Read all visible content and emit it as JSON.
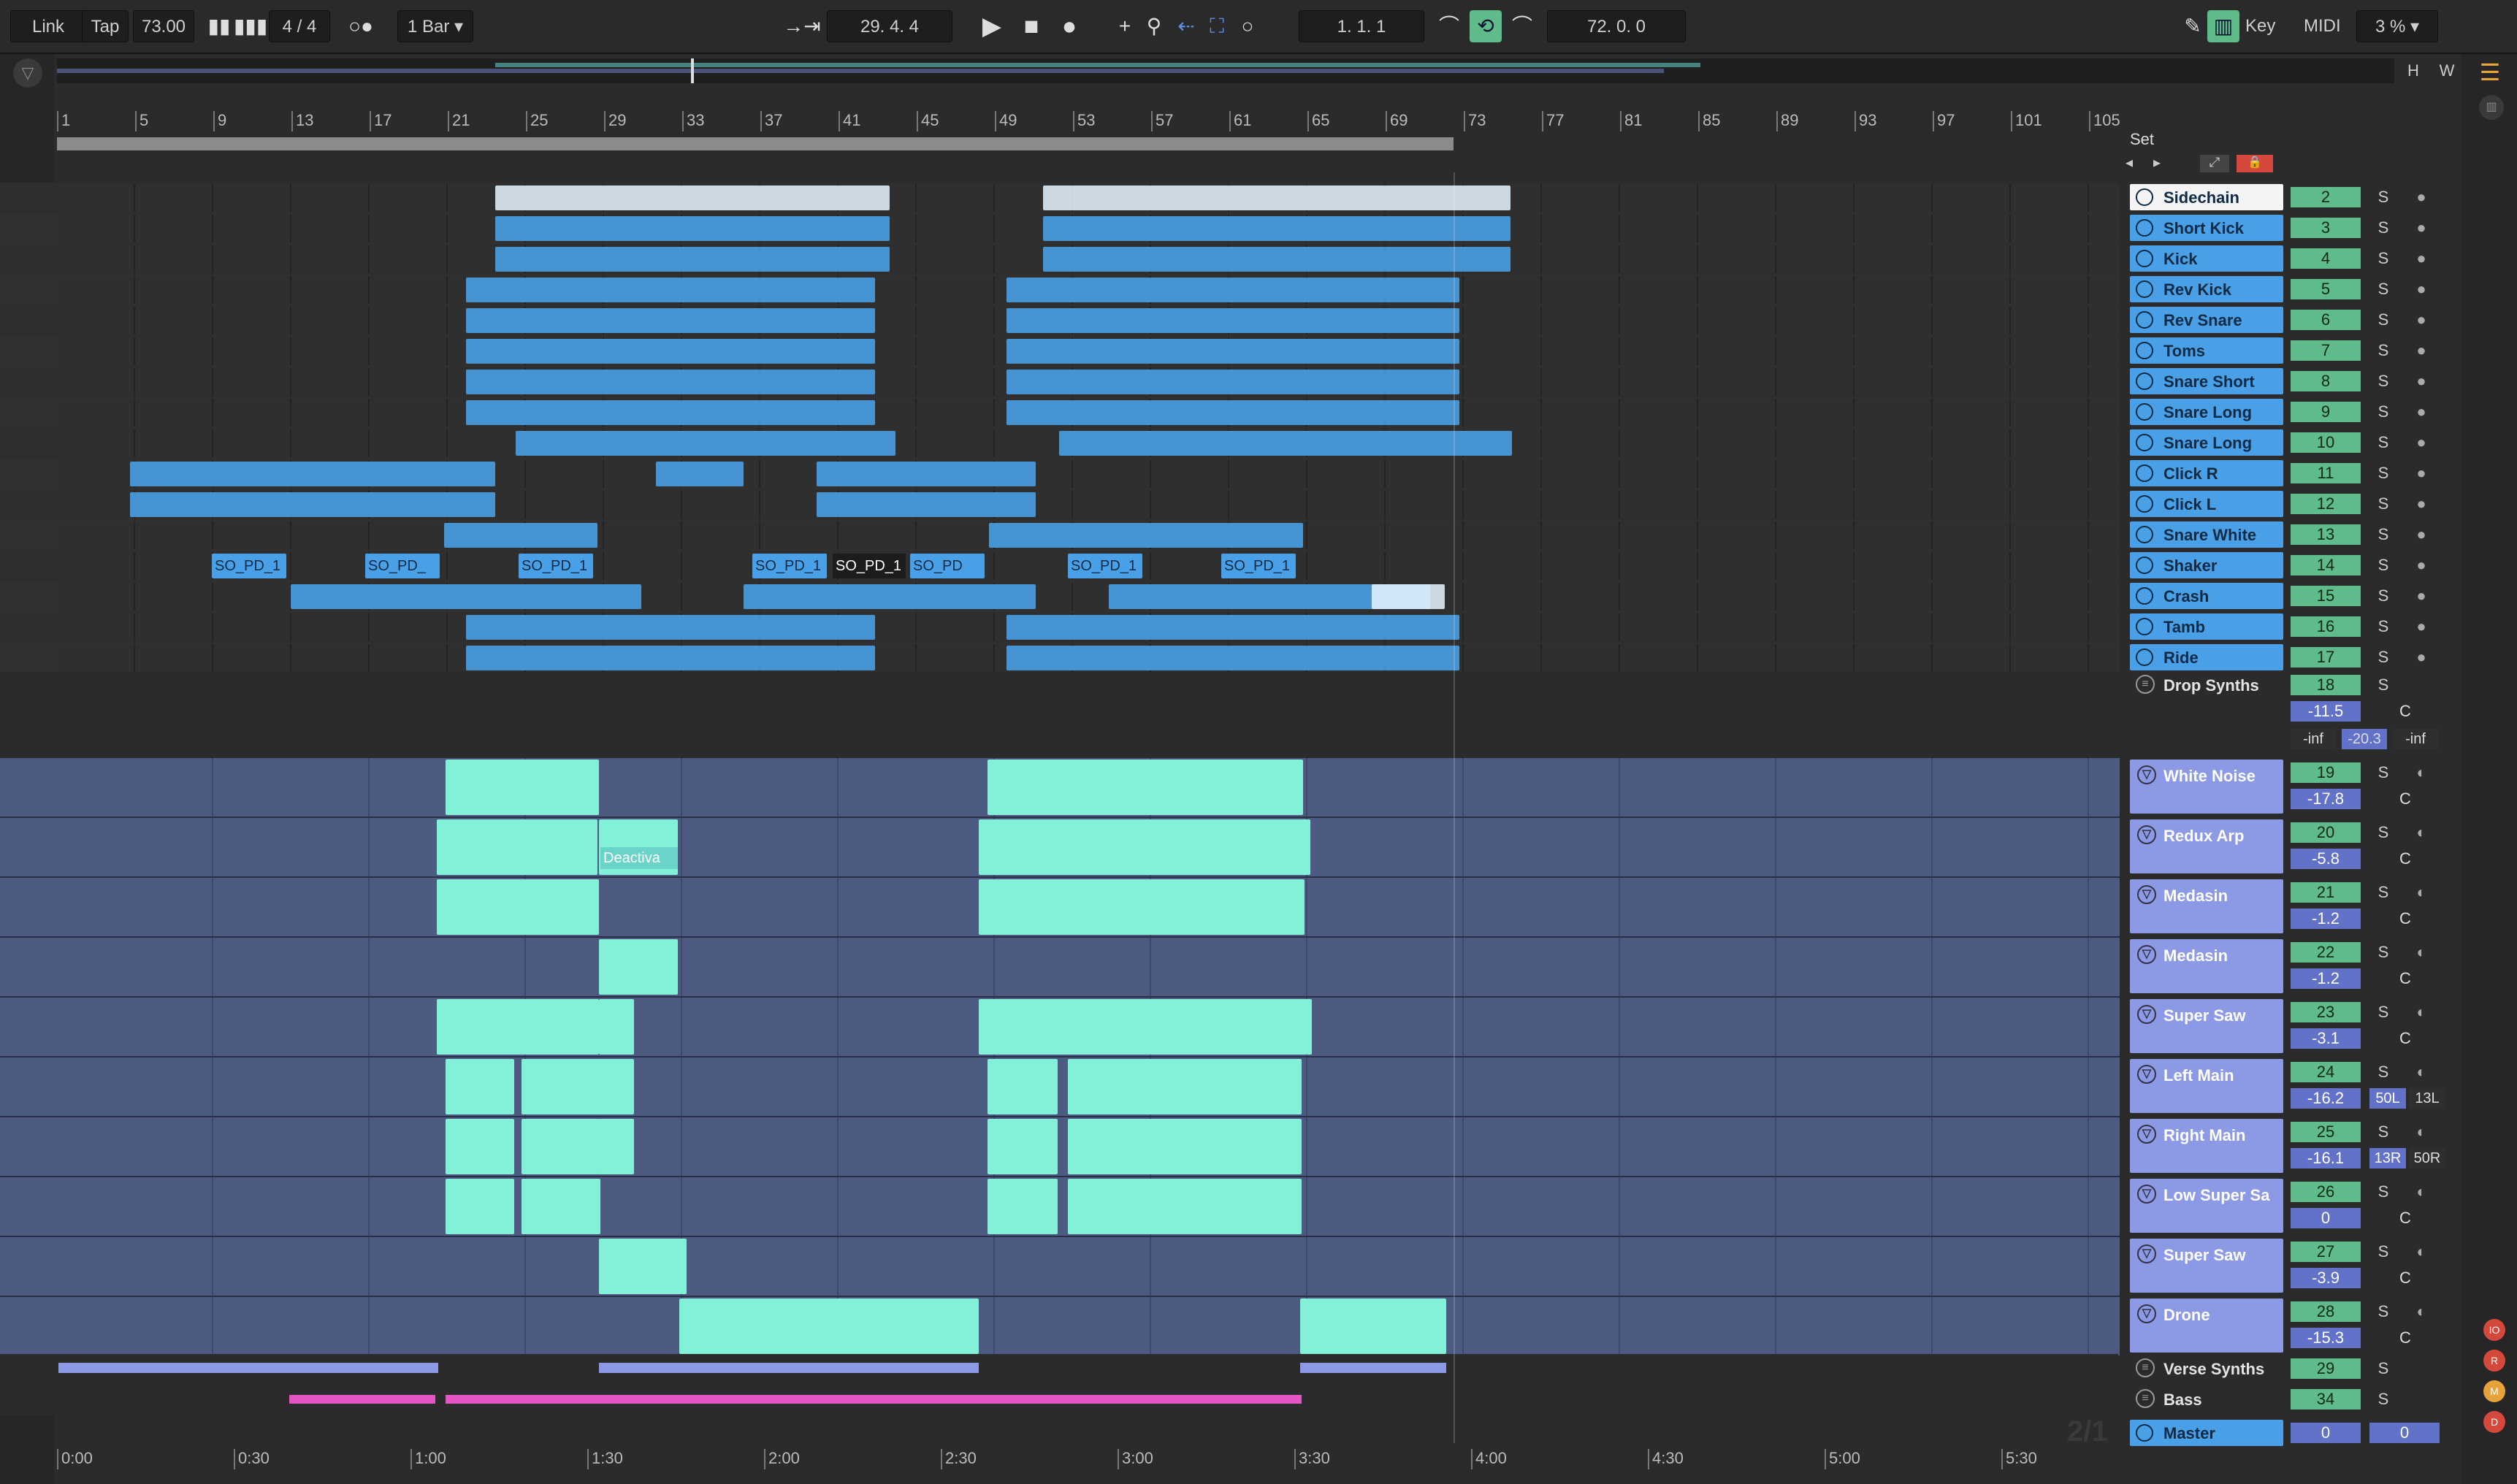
{
  "transport": {
    "link": "Link",
    "tap": "Tap",
    "tempo": "73.00",
    "time_signature": "4 / 4",
    "quantize": "1 Bar",
    "arrangement_position": "29.   4.   4",
    "loop_start": "1.   1.   1",
    "loop_length": "72.   0.   0",
    "key": "Key",
    "midi": "MIDI",
    "cpu": "3 %",
    "overview_h": "H",
    "overview_w": "W"
  },
  "bar_ruler": [
    "1",
    "5",
    "9",
    "13",
    "17",
    "21",
    "25",
    "29",
    "33",
    "37",
    "41",
    "45",
    "49",
    "53",
    "57",
    "61",
    "65",
    "69",
    "73",
    "77",
    "81",
    "85",
    "89",
    "93",
    "97",
    "101",
    "105"
  ],
  "time_ruler": [
    "0:00",
    "0:30",
    "1:00",
    "1:30",
    "2:00",
    "2:30",
    "3:00",
    "3:30",
    "4:00",
    "4:30",
    "5:00",
    "5:30"
  ],
  "page_indicator": "2/1",
  "set_label": "Set",
  "drum_tracks": [
    {
      "name": "Sidechain",
      "number": "2",
      "selected": true
    },
    {
      "name": "Short Kick",
      "number": "3"
    },
    {
      "name": "Kick",
      "number": "4"
    },
    {
      "name": "Rev Kick",
      "number": "5"
    },
    {
      "name": "Rev Snare",
      "number": "6"
    },
    {
      "name": "Toms",
      "number": "7"
    },
    {
      "name": "Snare Short",
      "number": "8"
    },
    {
      "name": "Snare Long",
      "number": "9"
    },
    {
      "name": "Snare Long",
      "number": "10"
    },
    {
      "name": "Click R",
      "number": "11"
    },
    {
      "name": "Click L",
      "number": "12"
    },
    {
      "name": "Snare White",
      "number": "13"
    },
    {
      "name": "Shaker",
      "number": "14"
    },
    {
      "name": "Crash",
      "number": "15"
    },
    {
      "name": "Tamb",
      "number": "16"
    },
    {
      "name": "Ride",
      "number": "17"
    }
  ],
  "drop_synths": {
    "name": "Drop Synths",
    "number": "18",
    "volume": "-11.5",
    "pan": "C",
    "sends": [
      "-inf",
      "-20.3",
      "-inf"
    ]
  },
  "synth_tracks": [
    {
      "name": "White Noise",
      "number": "19",
      "volume": "-17.8",
      "pan": "C"
    },
    {
      "name": "Redux Arp",
      "number": "20",
      "volume": "-5.8",
      "pan": "C"
    },
    {
      "name": "Medasin",
      "number": "21",
      "volume": "-1.2",
      "pan": "C"
    },
    {
      "name": "Medasin",
      "number": "22",
      "volume": "-1.2",
      "pan": "C"
    },
    {
      "name": "Super Saw",
      "number": "23",
      "volume": "-3.1",
      "pan": "C"
    },
    {
      "name": "Left Main",
      "number": "24",
      "volume": "-16.2",
      "pan": "50L",
      "pan2": "13L"
    },
    {
      "name": "Right Main",
      "number": "25",
      "volume": "-16.1",
      "pan": "13R",
      "pan2": "50R"
    },
    {
      "name": "Low Super Sa",
      "number": "26",
      "volume": "0",
      "pan": "C"
    },
    {
      "name": "Super Saw",
      "number": "27",
      "volume": "-3.9",
      "pan": "C"
    },
    {
      "name": "Drone",
      "number": "28",
      "volume": "-15.3",
      "pan": "C"
    }
  ],
  "group_tracks": [
    {
      "name": "Verse Synths",
      "number": "29"
    },
    {
      "name": "Bass",
      "number": "34"
    }
  ],
  "master": {
    "name": "Master",
    "number": "0",
    "volume": "0"
  },
  "clip_labels": [
    "SO_PD_1",
    "SO_PD_",
    "SO_PD_1",
    "SO_PD_1",
    "SO_PD_1",
    "SO_PD",
    "SO_PD_1",
    "SO_PD_1"
  ],
  "deactivated_clip": "Deactiva",
  "solo_label": "S",
  "right_badges": [
    "IO",
    "R",
    "M",
    "D"
  ]
}
